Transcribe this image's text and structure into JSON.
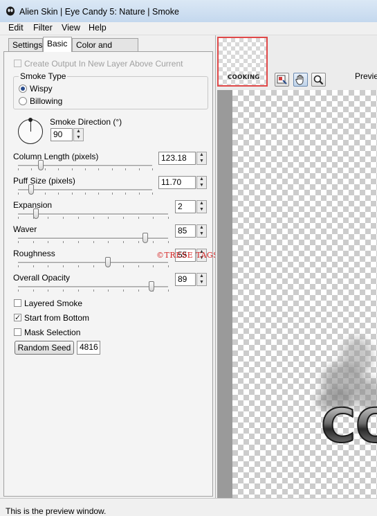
{
  "window": {
    "title": "Alien Skin | Eye Candy 5: Nature | Smoke"
  },
  "menu": {
    "items": [
      "Edit",
      "Filter",
      "View",
      "Help"
    ]
  },
  "tabs": [
    {
      "label": "Settings",
      "active": false
    },
    {
      "label": "Basic",
      "active": true
    },
    {
      "label": "Color and Lighting",
      "active": false
    }
  ],
  "basic": {
    "create_output": {
      "label": "Create Output In New Layer Above Current",
      "checked": false,
      "disabled": true
    },
    "smoke_type": {
      "title": "Smoke Type",
      "options": [
        {
          "label": "Wispy",
          "selected": true
        },
        {
          "label": "Billowing",
          "selected": false
        }
      ]
    },
    "smoke_direction": {
      "label": "Smoke Direction (°)",
      "value": "90"
    },
    "sliders": [
      {
        "label": "Column Length (pixels)",
        "value": "123.18",
        "level": 0.17
      },
      {
        "label": "Puff Size (pixels)",
        "value": "11.70",
        "level": 0.1
      },
      {
        "label": "Expansion",
        "value": "2",
        "level": 0.12
      },
      {
        "label": "Waver",
        "value": "85",
        "level": 0.85
      },
      {
        "label": "Roughness",
        "value": "55",
        "level": 0.6
      },
      {
        "label": "Overall Opacity",
        "value": "89",
        "level": 0.89
      }
    ],
    "checkboxes": [
      {
        "label": "Layered Smoke",
        "checked": false
      },
      {
        "label": "Start from Bottom",
        "checked": true
      },
      {
        "label": "Mask Selection",
        "checked": false
      }
    ],
    "random_seed": {
      "button_label": "Random Seed",
      "value": "4816"
    }
  },
  "watermark": "©TRESE TAGS",
  "preview": {
    "thumbnail_text": "COOKING",
    "label": "Preview",
    "art_text": "CO"
  },
  "status": {
    "text": "This is the preview window."
  },
  "colors": {
    "accent_border": "#e04848",
    "watermark": "#d42020"
  },
  "icons": [
    "app-icon",
    "navigator-icon",
    "hand-icon",
    "zoom-icon"
  ]
}
